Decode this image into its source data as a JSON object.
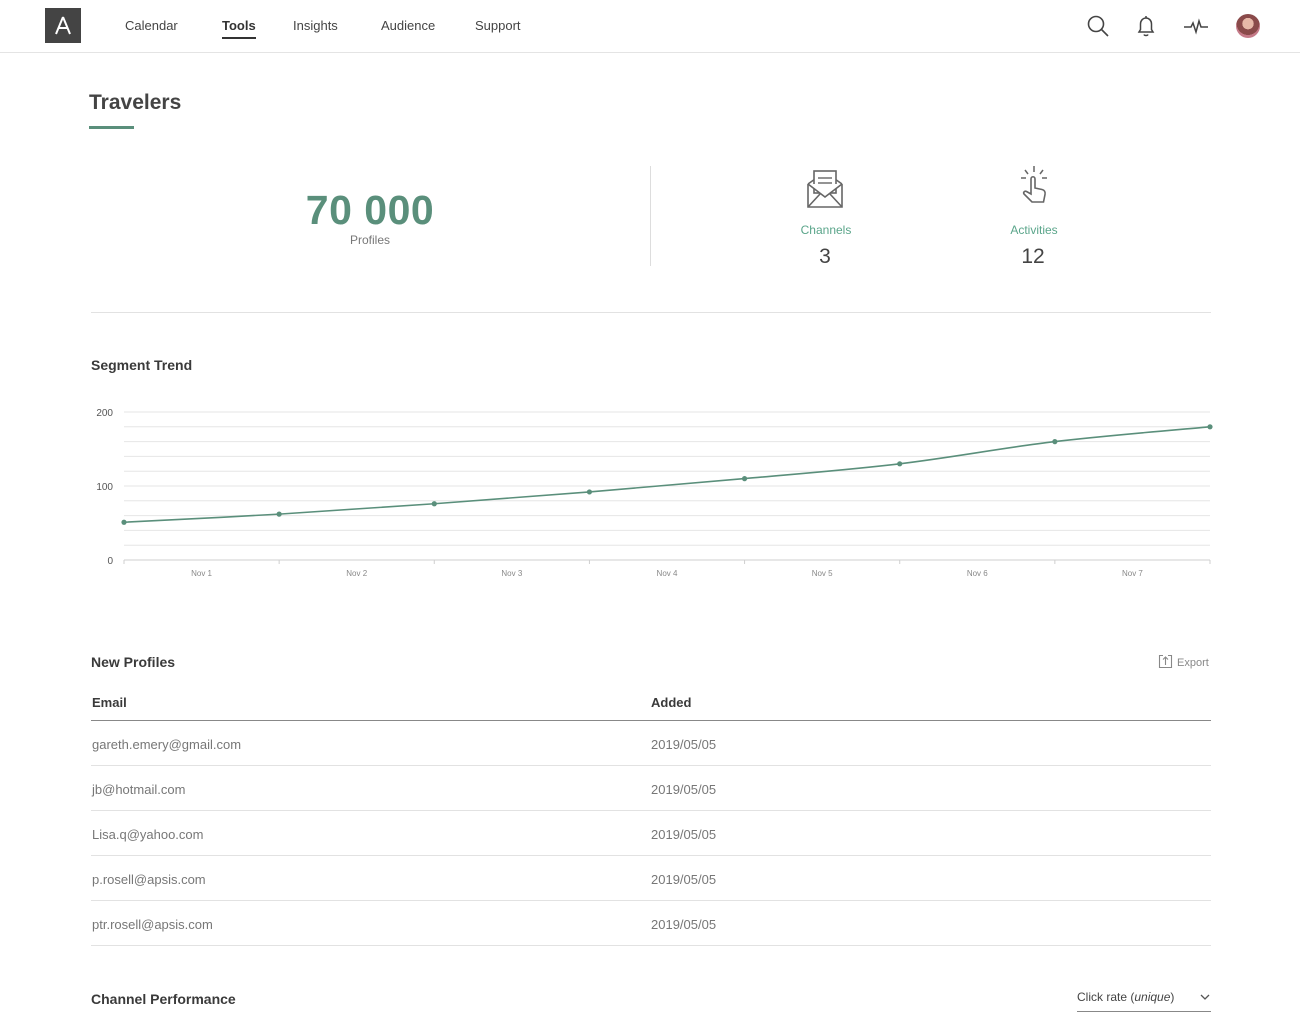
{
  "nav": {
    "items": [
      "Calendar",
      "Tools",
      "Insights",
      "Audience",
      "Support"
    ],
    "active": "Tools"
  },
  "page": {
    "title": "Travelers"
  },
  "stats": {
    "profiles_value": "70 000",
    "profiles_label": "Profiles",
    "channels_label": "Channels",
    "channels_value": "3",
    "activities_label": "Activities",
    "activities_value": "12"
  },
  "trend": {
    "title": "Segment Trend",
    "accent": "#5a8f7b"
  },
  "chart_data": {
    "type": "line",
    "title": "",
    "xlabel": "",
    "ylabel": "",
    "ylim": [
      0,
      200
    ],
    "yticks": [
      0,
      100,
      200
    ],
    "grid": true,
    "categories": [
      "Nov 1",
      "Nov 2",
      "Nov 3",
      "Nov 4",
      "Nov 5",
      "Nov 6",
      "Nov 7"
    ],
    "x": [
      "Nov 1 start",
      "Nov 2 start",
      "Nov 3 start",
      "Nov 4 start",
      "Nov 5 start",
      "Nov 6 start",
      "Nov 7 start",
      "Nov 7 end"
    ],
    "series": [
      {
        "values": [
          51,
          62,
          76,
          92,
          110,
          130,
          160,
          180
        ]
      }
    ]
  },
  "profiles_table": {
    "title": "New Profiles",
    "export_label": "Export",
    "columns": [
      "Email",
      "Added"
    ],
    "rows": [
      [
        "gareth.emery@gmail.com",
        "2019/05/05"
      ],
      [
        "jb@hotmail.com",
        "2019/05/05"
      ],
      [
        "Lisa.q@yahoo.com",
        "2019/05/05"
      ],
      [
        "p.rosell@apsis.com",
        "2019/05/05"
      ],
      [
        "ptr.rosell@apsis.com",
        "2019/05/05"
      ]
    ]
  },
  "performance": {
    "title": "Channel Performance",
    "metric_prefix": "Click rate (",
    "metric_emphasis": "unique",
    "metric_suffix": ")"
  },
  "icons": {
    "logo": "apsis-logo-icon",
    "search": "search-icon",
    "bell": "bell-icon",
    "activity": "pulse-icon",
    "channels": "envelope-icon",
    "activities": "tap-icon",
    "export": "export-icon",
    "dropdown": "chevron-down-icon"
  }
}
